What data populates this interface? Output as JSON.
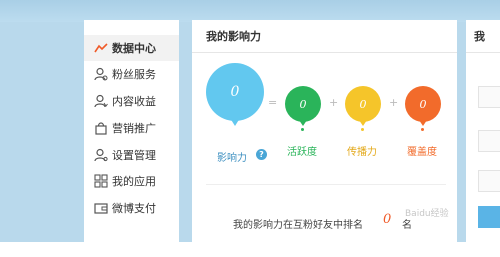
{
  "sidebar": {
    "items": [
      {
        "label": "数据中心",
        "icon": "trend-line-icon",
        "active": true
      },
      {
        "label": "粉丝服务",
        "icon": "user-icon"
      },
      {
        "label": "内容收益",
        "icon": "user-coin-icon"
      },
      {
        "label": "营销推广",
        "icon": "shopping-bag-icon"
      },
      {
        "label": "设置管理",
        "icon": "user-settings-icon"
      },
      {
        "label": "我的应用",
        "icon": "apps-grid-icon"
      },
      {
        "label": "微博支付",
        "icon": "wallet-icon"
      }
    ]
  },
  "main": {
    "title": "我的影响力",
    "influence": {
      "value": "0",
      "label": "影响力",
      "help": "?",
      "color": "#62c8ef"
    },
    "ops": {
      "eq": "=",
      "plus1": "+",
      "plus2": "+"
    },
    "metrics": [
      {
        "value": "0",
        "label": "活跃度",
        "color": "#2ab45a"
      },
      {
        "value": "0",
        "label": "传播力",
        "color": "#f5c52a"
      },
      {
        "value": "0",
        "label": "覆盖度",
        "color": "#f26b2b"
      }
    ],
    "rank": {
      "prefix": "我的影响力在互粉好友中排名",
      "value": "0",
      "suffix": "名"
    }
  },
  "right_panel": {
    "title": "我"
  },
  "watermark": "Baidu经验"
}
